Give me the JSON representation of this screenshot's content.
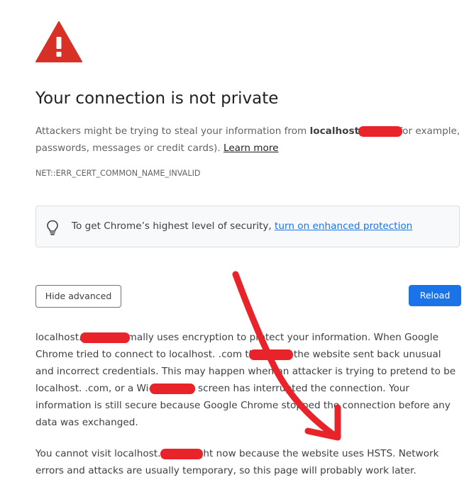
{
  "title": "Your connection is not private",
  "intro": {
    "before_host": "Attackers might be trying to steal your information from ",
    "host": "localhost.        .com",
    "after_host": " (for example, passwords, messages or credit cards). ",
    "learn_more": "Learn more"
  },
  "error_code": "NET::ERR_CERT_COMMON_NAME_INVALID",
  "security_box": {
    "text": "To get Chrome’s highest level of security, ",
    "link": "turn on enhanced protection"
  },
  "buttons": {
    "hide_advanced": "Hide advanced",
    "reload": "Reload"
  },
  "details": "localhost.        .com normally uses encryption to protect your information. When Google Chrome tried to connect to localhost.        .com this time, the website sent back unusual and incorrect credentials. This may happen when an attacker is trying to pretend to be localhost.        .com, or a Wi-Fi sign-in screen has interrupted the connection. Your information is still secure because Google Chrome stopped the connection before any data was exchanged.",
  "hsts": "You cannot visit localhost.        .com right now because the website uses HSTS. Network errors and attacks are usually temporary, so this page will probably work later.",
  "colors": {
    "warning_red": "#d93025",
    "primary_blue": "#1a73e8",
    "annotation_red": "#e8232a"
  },
  "icons": {
    "warning": "warning-triangle-icon",
    "security_tip": "lightbulb-icon"
  }
}
